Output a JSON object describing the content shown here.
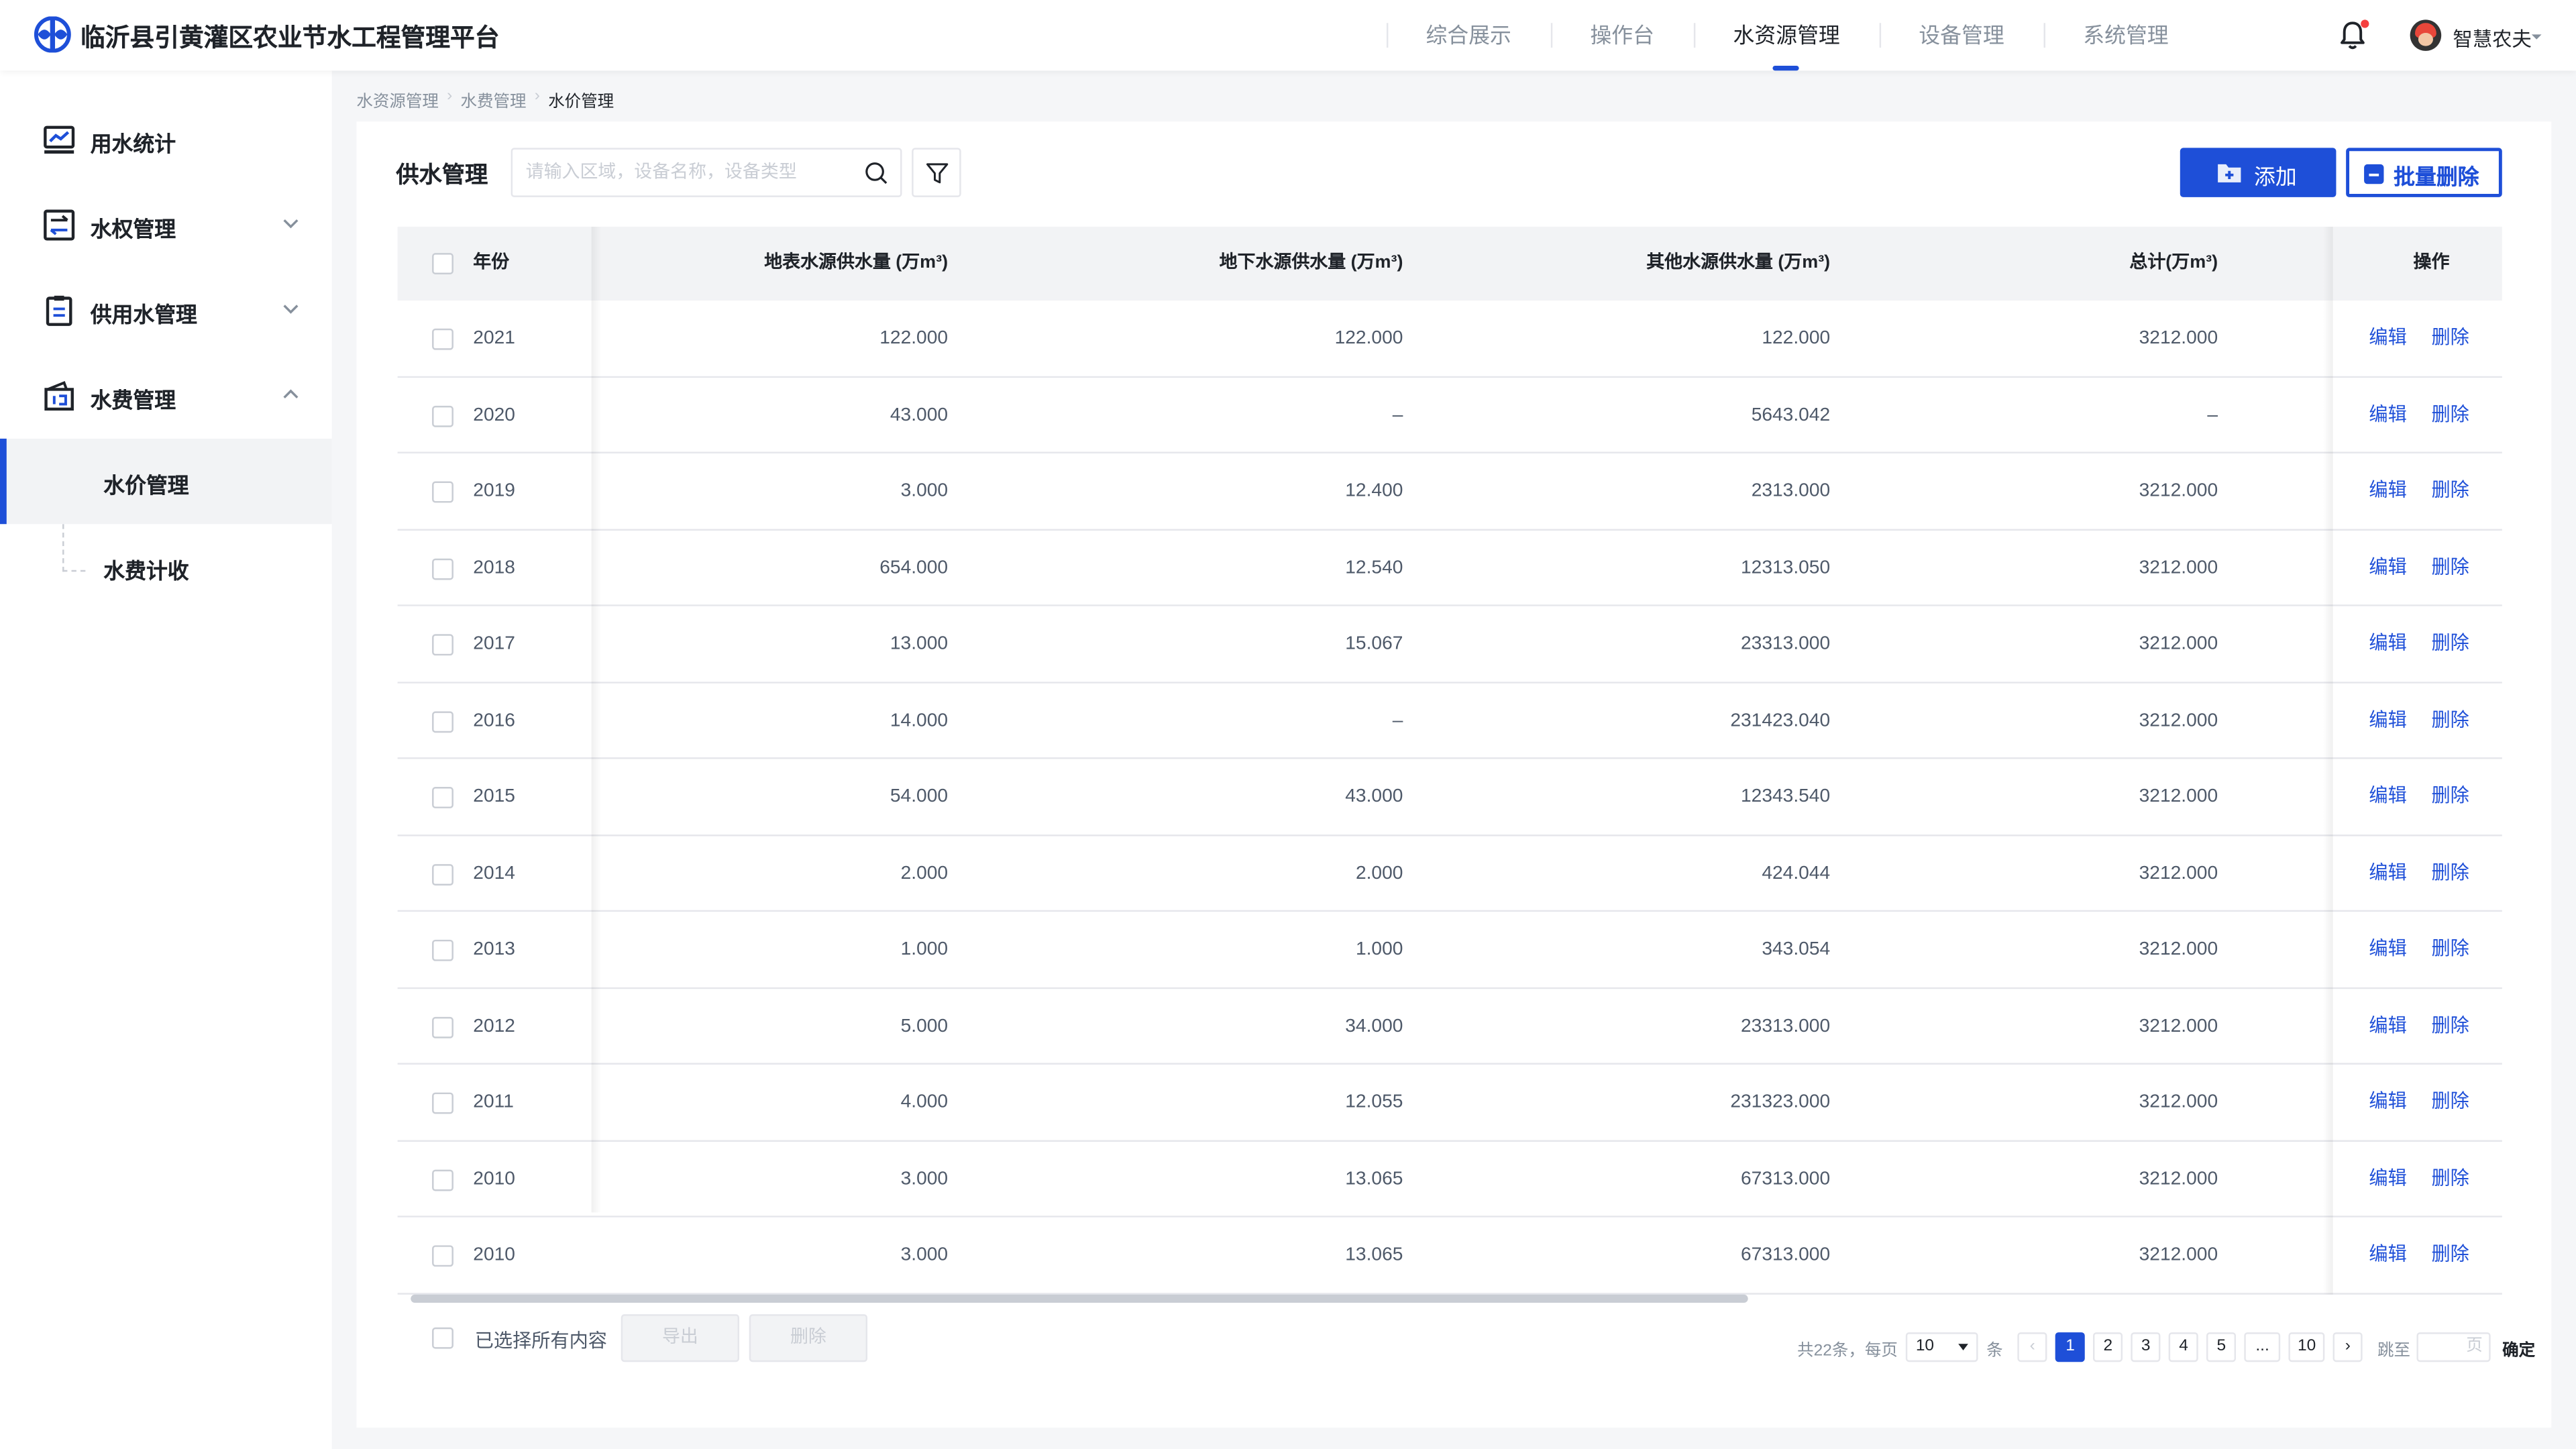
{
  "app": {
    "title": "临沂县引黄灌区农业节水工程管理平台"
  },
  "topnav": [
    {
      "label": "综合展示",
      "active": false
    },
    {
      "label": "操作台",
      "active": false
    },
    {
      "label": "水资源管理",
      "active": true
    },
    {
      "label": "设备管理",
      "active": false
    },
    {
      "label": "系统管理",
      "active": false
    }
  ],
  "user": {
    "name": "智慧农夫"
  },
  "sidebar": {
    "items": [
      {
        "label": "用水统计",
        "icon": "chart-icon"
      },
      {
        "label": "水权管理",
        "icon": "exchange-icon"
      },
      {
        "label": "供用水管理",
        "icon": "clipboard-icon"
      },
      {
        "label": "水费管理",
        "icon": "wallet-icon"
      }
    ],
    "subitems": [
      {
        "label": "水价管理",
        "active": true
      },
      {
        "label": "水费计收",
        "active": false
      }
    ]
  },
  "breadcrumb": [
    "水资源管理",
    "水费管理",
    "水价管理"
  ],
  "main": {
    "title": "供水管理",
    "search_placeholder": "请输入区域，设备名称，设备类型",
    "add_label": "添加",
    "batch_delete_label": "批量删除"
  },
  "table": {
    "headers": {
      "year": "年份",
      "surface": "地表水源供水量 (万m³)",
      "ground": "地下水源供水量 (万m³)",
      "other": "其他水源供水量 (万m³)",
      "total": "总计(万m³)",
      "op": "操作"
    },
    "edit_label": "编辑",
    "delete_label": "删除",
    "rows": [
      {
        "year": "2021",
        "surface": "122.000",
        "ground": "122.000",
        "other": "122.000",
        "total": "3212.000"
      },
      {
        "year": "2020",
        "surface": "43.000",
        "ground": "–",
        "other": "5643.042",
        "total": "–"
      },
      {
        "year": "2019",
        "surface": "3.000",
        "ground": "12.400",
        "other": "2313.000",
        "total": "3212.000"
      },
      {
        "year": "2018",
        "surface": "654.000",
        "ground": "12.540",
        "other": "12313.050",
        "total": "3212.000"
      },
      {
        "year": "2017",
        "surface": "13.000",
        "ground": "15.067",
        "other": "23313.000",
        "total": "3212.000"
      },
      {
        "year": "2016",
        "surface": "14.000",
        "ground": "–",
        "other": "231423.040",
        "total": "3212.000"
      },
      {
        "year": "2015",
        "surface": "54.000",
        "ground": "43.000",
        "other": "12343.540",
        "total": "3212.000"
      },
      {
        "year": "2014",
        "surface": "2.000",
        "ground": "2.000",
        "other": "424.044",
        "total": "3212.000"
      },
      {
        "year": "2013",
        "surface": "1.000",
        "ground": "1.000",
        "other": "343.054",
        "total": "3212.000"
      },
      {
        "year": "2012",
        "surface": "5.000",
        "ground": "34.000",
        "other": "23313.000",
        "total": "3212.000"
      },
      {
        "year": "2011",
        "surface": "4.000",
        "ground": "12.055",
        "other": "231323.000",
        "total": "3212.000"
      },
      {
        "year": "2010",
        "surface": "3.000",
        "ground": "13.065",
        "other": "67313.000",
        "total": "3212.000"
      },
      {
        "year": "2010",
        "surface": "3.000",
        "ground": "13.065",
        "other": "67313.000",
        "total": "3212.000"
      }
    ]
  },
  "footer": {
    "select_all_label": "已选择所有内容",
    "export_label": "导出",
    "delete_label": "删除"
  },
  "pagination": {
    "total_text": "共22条，每页",
    "page_size": "10",
    "unit": "条",
    "prev": "‹",
    "pages": [
      "1",
      "2",
      "3",
      "4",
      "5",
      "...",
      "10"
    ],
    "current": "1",
    "next": "›",
    "jump_label": "跳至",
    "page_unit": "页",
    "confirm_label": "确定"
  },
  "colors": {
    "primary": "#1e4fd8",
    "alert": "#f53f3f"
  }
}
